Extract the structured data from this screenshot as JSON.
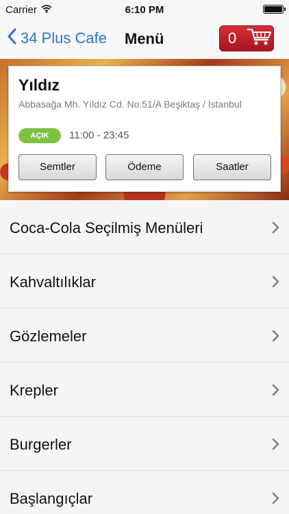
{
  "status_bar": {
    "carrier": "Carrier",
    "time": "6:10 PM",
    "battery_level": 1.0
  },
  "nav": {
    "back_label": "34 Plus Cafe",
    "title": "Menü",
    "cart_count": "0",
    "icons": {
      "back": "chevron-left-icon",
      "cart": "shopping-cart-icon"
    }
  },
  "restaurant": {
    "name": "Yıldız",
    "address": "Abbasağa Mh. Yıldız Cd. No:51/A Beşiktaş / İstanbul",
    "status_badge": "AÇIK",
    "hours": "11:00 - 23:45",
    "buttons": [
      "Semtler",
      "Ödeme",
      "Saatler"
    ]
  },
  "menu": {
    "items": [
      {
        "label": "Coca-Cola Seçilmiş Menüleri"
      },
      {
        "label": "Kahvaltılıklar"
      },
      {
        "label": "Gözlemeler"
      },
      {
        "label": "Krepler"
      },
      {
        "label": "Burgerler"
      },
      {
        "label": "Başlangıçlar"
      }
    ]
  },
  "colors": {
    "accent_blue": "#2e73c7",
    "cart_red": "#c0202b",
    "open_green": "#7dc242"
  }
}
